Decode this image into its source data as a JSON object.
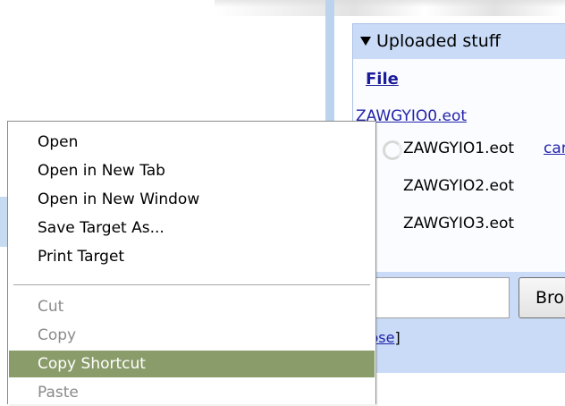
{
  "panel": {
    "title": "Uploaded stuff",
    "file_column_header": "File",
    "files": [
      {
        "name": "ZAWGYIO0.eot"
      },
      {
        "name": "ZAWGYIO1.eot",
        "action": "car"
      },
      {
        "name": "ZAWGYIO2.eot"
      },
      {
        "name": "ZAWGYIO3.eot"
      }
    ],
    "browse_label": "Bro",
    "close_prefix": "[",
    "close_label": "close",
    "close_suffix": "]"
  },
  "context_menu": {
    "items": [
      {
        "label": "Open",
        "state": "normal"
      },
      {
        "label": "Open in New Tab",
        "state": "normal"
      },
      {
        "label": "Open in New Window",
        "state": "normal"
      },
      {
        "label": "Save Target As...",
        "state": "normal"
      },
      {
        "label": "Print Target",
        "state": "normal"
      },
      {
        "label": "Cut",
        "state": "disabled"
      },
      {
        "label": "Copy",
        "state": "disabled"
      },
      {
        "label": "Copy Shortcut",
        "state": "selected"
      },
      {
        "label": "Paste",
        "state": "disabled"
      }
    ],
    "highlight_color": "#8b9c6b"
  },
  "colors": {
    "link": "#2324a9",
    "panel_bg": "#c9dbf7"
  }
}
